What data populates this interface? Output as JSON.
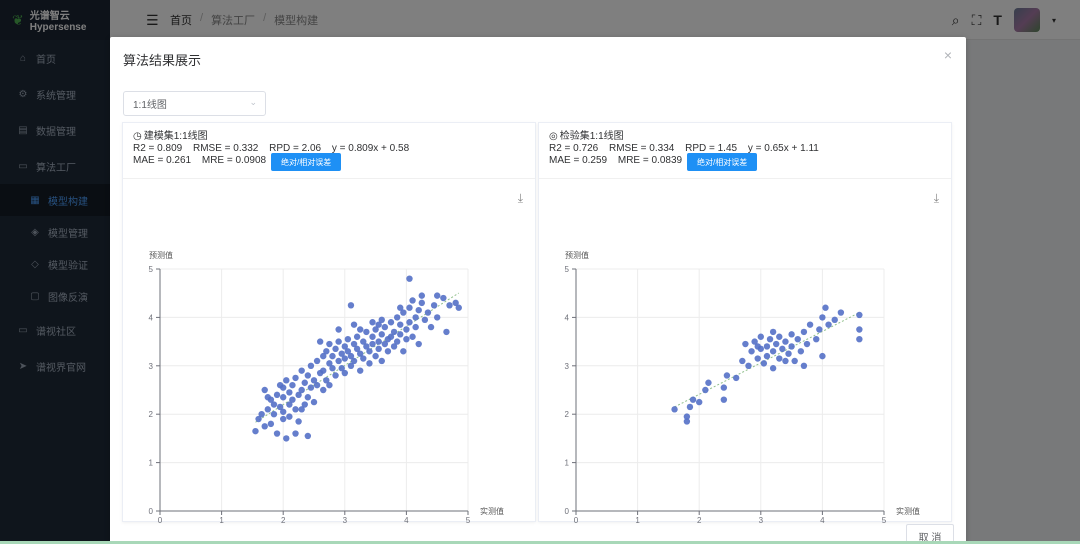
{
  "app": {
    "title": "光谱智云Hypersense"
  },
  "sidebar": {
    "items": [
      {
        "label": "首页",
        "icon": "home-icon",
        "glyph": "⌂"
      },
      {
        "label": "系统管理",
        "icon": "gear-icon",
        "glyph": "⚙"
      },
      {
        "label": "数据管理",
        "icon": "database-icon",
        "glyph": "▤"
      },
      {
        "label": "算法工厂",
        "icon": "monitor-icon",
        "glyph": "▭"
      }
    ],
    "sub_items": [
      {
        "label": "模型构建",
        "icon": "build-icon",
        "glyph": "▦",
        "active": true
      },
      {
        "label": "模型管理",
        "icon": "manage-icon",
        "glyph": "◈"
      },
      {
        "label": "模型验证",
        "icon": "shield-icon",
        "glyph": "◇"
      },
      {
        "label": "图像反演",
        "icon": "image-icon",
        "glyph": "▢"
      }
    ],
    "bottom_items": [
      {
        "label": "谱视社区",
        "icon": "community-icon",
        "glyph": "▭"
      },
      {
        "label": "谱视界官网",
        "icon": "send-icon",
        "glyph": "➤"
      }
    ]
  },
  "header": {
    "breadcrumb": [
      "首页",
      "算法工厂",
      "模型构建"
    ]
  },
  "dialog": {
    "title": "算法结果展示",
    "close_glyph": "×",
    "select_value": "1:1线图",
    "cancel_label": "取 消",
    "error_button_label": "绝对/相对误差",
    "panels": [
      {
        "title": "建模集1:1线图",
        "stats_row1": [
          "R2 = 0.809",
          "RMSE = 0.332",
          "RPD = 2.06",
          "y = 0.809x + 0.58"
        ],
        "stats_row2": [
          "MAE = 0.261",
          "MRE = 0.0908"
        ]
      },
      {
        "title": "检验集1:1线图",
        "stats_row1": [
          "R2 = 0.726",
          "RMSE = 0.334",
          "RPD = 1.45",
          "y = 0.65x + 1.11"
        ],
        "stats_row2": [
          "MAE = 0.259",
          "MRE = 0.0839"
        ]
      }
    ]
  },
  "chart_data": [
    {
      "type": "scatter",
      "title": "建模集1:1线图",
      "xlabel": "实测值",
      "ylabel": "预测值",
      "xlim": [
        0,
        5
      ],
      "ylim": [
        0,
        5
      ],
      "x_ticks": [
        "0",
        "1",
        "2",
        "3",
        "4",
        "5"
      ],
      "y_ticks": [
        "0",
        "1",
        "2",
        "3",
        "4",
        "5"
      ],
      "grid": true,
      "color": "#5470c6",
      "fit_line": {
        "slope": 0.809,
        "intercept": 0.58
      },
      "points": [
        [
          1.55,
          1.65
        ],
        [
          1.6,
          1.9
        ],
        [
          1.65,
          2.0
        ],
        [
          1.7,
          2.5
        ],
        [
          1.7,
          1.75
        ],
        [
          1.75,
          2.1
        ],
        [
          1.8,
          2.3
        ],
        [
          1.8,
          1.8
        ],
        [
          1.85,
          2.2
        ],
        [
          1.85,
          2.0
        ],
        [
          1.9,
          1.6
        ],
        [
          1.9,
          2.4
        ],
        [
          1.95,
          2.6
        ],
        [
          1.95,
          2.15
        ],
        [
          2.0,
          1.9
        ],
        [
          2.0,
          2.35
        ],
        [
          2.0,
          2.05
        ],
        [
          2.05,
          2.7
        ],
        [
          2.05,
          1.5
        ],
        [
          2.1,
          2.2
        ],
        [
          2.1,
          2.45
        ],
        [
          2.1,
          1.95
        ],
        [
          2.15,
          2.6
        ],
        [
          2.15,
          2.3
        ],
        [
          2.2,
          2.1
        ],
        [
          2.2,
          2.75
        ],
        [
          2.25,
          2.4
        ],
        [
          2.25,
          1.85
        ],
        [
          2.3,
          2.9
        ],
        [
          2.3,
          2.5
        ],
        [
          2.35,
          2.2
        ],
        [
          2.35,
          2.65
        ],
        [
          2.4,
          2.8
        ],
        [
          2.4,
          2.35
        ],
        [
          2.45,
          3.0
        ],
        [
          2.45,
          2.55
        ],
        [
          2.5,
          2.7
        ],
        [
          2.5,
          2.25
        ],
        [
          2.55,
          3.1
        ],
        [
          2.55,
          2.6
        ],
        [
          2.6,
          2.85
        ],
        [
          2.6,
          3.5
        ],
        [
          2.65,
          3.2
        ],
        [
          2.65,
          2.9
        ],
        [
          2.7,
          2.7
        ],
        [
          2.7,
          3.3
        ],
        [
          2.75,
          3.05
        ],
        [
          2.75,
          3.45
        ],
        [
          2.8,
          2.95
        ],
        [
          2.8,
          3.2
        ],
        [
          2.85,
          3.35
        ],
        [
          2.85,
          2.8
        ],
        [
          2.9,
          3.1
        ],
        [
          2.9,
          3.5
        ],
        [
          2.95,
          3.25
        ],
        [
          2.95,
          2.95
        ],
        [
          3.0,
          3.4
        ],
        [
          3.0,
          3.15
        ],
        [
          3.0,
          2.85
        ],
        [
          3.05,
          3.3
        ],
        [
          3.05,
          3.55
        ],
        [
          3.1,
          3.2
        ],
        [
          3.1,
          3.0
        ],
        [
          3.1,
          4.25
        ],
        [
          3.15,
          3.45
        ],
        [
          3.15,
          3.1
        ],
        [
          3.2,
          3.35
        ],
        [
          3.2,
          3.6
        ],
        [
          3.25,
          3.25
        ],
        [
          3.25,
          2.9
        ],
        [
          3.3,
          3.5
        ],
        [
          3.3,
          3.15
        ],
        [
          3.35,
          3.4
        ],
        [
          3.35,
          3.7
        ],
        [
          3.4,
          3.3
        ],
        [
          3.4,
          3.05
        ],
        [
          3.45,
          3.6
        ],
        [
          3.45,
          3.45
        ],
        [
          3.5,
          3.2
        ],
        [
          3.5,
          3.75
        ],
        [
          3.55,
          3.5
        ],
        [
          3.55,
          3.35
        ],
        [
          3.6,
          3.65
        ],
        [
          3.6,
          3.1
        ],
        [
          3.65,
          3.8
        ],
        [
          3.65,
          3.45
        ],
        [
          3.7,
          3.55
        ],
        [
          3.7,
          3.3
        ],
        [
          3.75,
          3.9
        ],
        [
          3.75,
          3.6
        ],
        [
          3.8,
          3.4
        ],
        [
          3.8,
          3.7
        ],
        [
          3.85,
          4.0
        ],
        [
          3.85,
          3.5
        ],
        [
          3.9,
          3.65
        ],
        [
          3.9,
          3.85
        ],
        [
          3.95,
          3.3
        ],
        [
          3.95,
          4.1
        ],
        [
          4.0,
          3.75
        ],
        [
          4.0,
          3.55
        ],
        [
          4.05,
          4.2
        ],
        [
          4.05,
          3.9
        ],
        [
          4.1,
          3.6
        ],
        [
          4.1,
          4.35
        ],
        [
          4.15,
          4.0
        ],
        [
          4.15,
          3.8
        ],
        [
          4.2,
          4.15
        ],
        [
          4.2,
          3.45
        ],
        [
          4.25,
          4.3
        ],
        [
          4.3,
          3.95
        ],
        [
          4.35,
          4.1
        ],
        [
          4.4,
          3.8
        ],
        [
          4.45,
          4.25
        ],
        [
          4.5,
          4.0
        ],
        [
          4.6,
          4.4
        ],
        [
          4.65,
          3.7
        ],
        [
          4.7,
          4.25
        ],
        [
          4.8,
          4.3
        ],
        [
          4.85,
          4.2
        ],
        [
          4.05,
          4.8
        ],
        [
          3.45,
          3.9
        ],
        [
          2.2,
          1.6
        ],
        [
          2.4,
          1.55
        ],
        [
          3.9,
          4.2
        ],
        [
          4.25,
          4.45
        ],
        [
          4.5,
          4.45
        ],
        [
          3.6,
          3.95
        ],
        [
          2.0,
          2.55
        ],
        [
          2.3,
          2.1
        ],
        [
          3.15,
          3.85
        ],
        [
          2.75,
          2.6
        ],
        [
          1.75,
          2.35
        ],
        [
          2.9,
          3.75
        ],
        [
          3.25,
          3.75
        ],
        [
          3.55,
          3.85
        ],
        [
          2.65,
          2.5
        ]
      ]
    },
    {
      "type": "scatter",
      "title": "检验集1:1线图",
      "xlabel": "实测值",
      "ylabel": "预测值",
      "xlim": [
        0,
        5
      ],
      "ylim": [
        0,
        5
      ],
      "x_ticks": [
        "0",
        "1",
        "2",
        "3",
        "4",
        "5"
      ],
      "y_ticks": [
        "0",
        "1",
        "2",
        "3",
        "4",
        "5"
      ],
      "grid": true,
      "color": "#5470c6",
      "fit_line": {
        "slope": 0.65,
        "intercept": 1.11
      },
      "points": [
        [
          1.6,
          2.1
        ],
        [
          1.8,
          1.85
        ],
        [
          1.8,
          1.95
        ],
        [
          1.85,
          2.15
        ],
        [
          1.9,
          2.3
        ],
        [
          2.0,
          2.25
        ],
        [
          2.1,
          2.5
        ],
        [
          2.15,
          2.65
        ],
        [
          2.4,
          2.3
        ],
        [
          2.4,
          2.55
        ],
        [
          2.45,
          2.8
        ],
        [
          2.6,
          2.75
        ],
        [
          2.7,
          3.1
        ],
        [
          2.75,
          3.45
        ],
        [
          2.8,
          3.0
        ],
        [
          2.85,
          3.3
        ],
        [
          2.9,
          3.5
        ],
        [
          2.95,
          3.15
        ],
        [
          3.0,
          3.6
        ],
        [
          3.0,
          3.35
        ],
        [
          3.05,
          3.05
        ],
        [
          3.1,
          3.4
        ],
        [
          3.1,
          3.2
        ],
        [
          3.15,
          3.55
        ],
        [
          3.2,
          3.3
        ],
        [
          3.2,
          2.95
        ],
        [
          3.25,
          3.45
        ],
        [
          3.3,
          3.15
        ],
        [
          3.3,
          3.6
        ],
        [
          3.35,
          3.35
        ],
        [
          3.4,
          3.5
        ],
        [
          3.45,
          3.25
        ],
        [
          3.5,
          3.65
        ],
        [
          3.5,
          3.4
        ],
        [
          3.55,
          3.1
        ],
        [
          3.6,
          3.55
        ],
        [
          3.65,
          3.3
        ],
        [
          3.7,
          3.7
        ],
        [
          3.75,
          3.45
        ],
        [
          3.8,
          3.85
        ],
        [
          3.9,
          3.55
        ],
        [
          3.95,
          3.75
        ],
        [
          4.0,
          4.0
        ],
        [
          4.0,
          3.2
        ],
        [
          4.05,
          4.2
        ],
        [
          4.1,
          3.85
        ],
        [
          4.2,
          3.95
        ],
        [
          4.3,
          4.1
        ],
        [
          4.6,
          4.05
        ],
        [
          4.6,
          3.75
        ],
        [
          4.6,
          3.55
        ],
        [
          3.2,
          3.7
        ],
        [
          3.4,
          3.1
        ],
        [
          2.95,
          3.4
        ],
        [
          3.7,
          3.0
        ]
      ]
    }
  ]
}
